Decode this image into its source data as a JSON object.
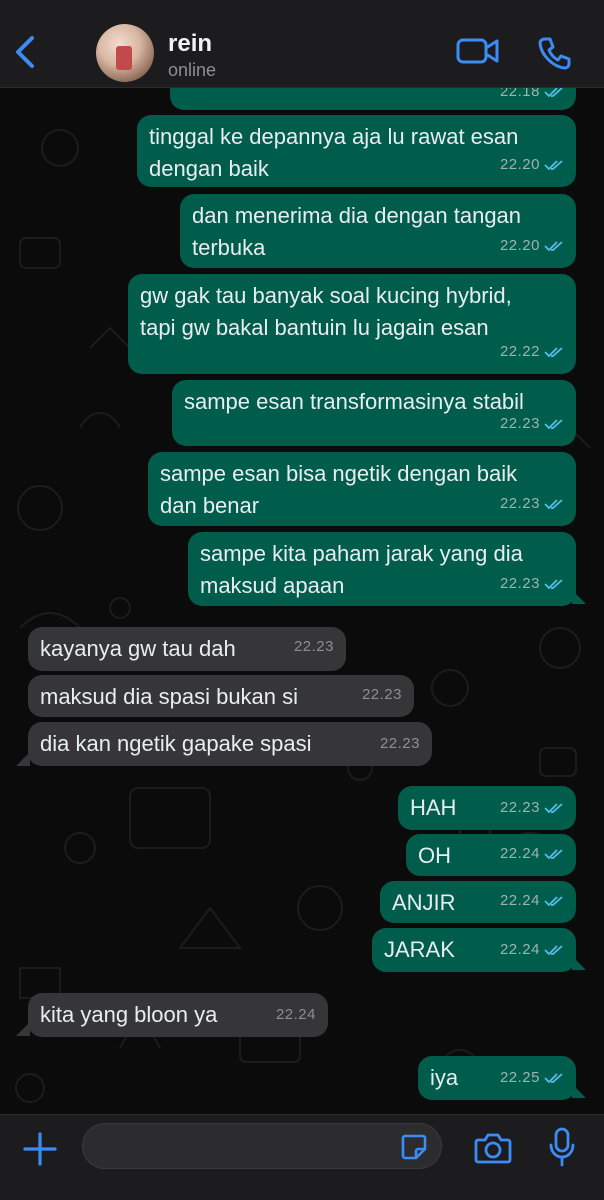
{
  "header": {
    "contact_name": "rein",
    "status": "online"
  },
  "messages": [
    {
      "dir": "out",
      "text": "",
      "time": "22.18",
      "read": true
    },
    {
      "dir": "out",
      "text": "tinggal ke depannya aja lu rawat esan\ndengan baik",
      "time": "22.20",
      "read": true
    },
    {
      "dir": "out",
      "text": "dan menerima dia dengan tangan\nterbuka",
      "time": "22.20",
      "read": true
    },
    {
      "dir": "out",
      "text": "gw gak tau banyak soal kucing hybrid,\ntapi gw bakal bantuin lu jagain esan",
      "time": "22.22",
      "read": true
    },
    {
      "dir": "out",
      "text": "sampe esan transformasinya stabil",
      "time": "22.23",
      "read": true
    },
    {
      "dir": "out",
      "text": "sampe esan bisa ngetik dengan baik\ndan benar",
      "time": "22.23",
      "read": true
    },
    {
      "dir": "out",
      "text": "sampe kita paham jarak yang dia\nmaksud apaan",
      "time": "22.23",
      "read": true
    },
    {
      "dir": "in",
      "text": "kayanya gw tau dah",
      "time": "22.23"
    },
    {
      "dir": "in",
      "text": "maksud dia spasi bukan si",
      "time": "22.23"
    },
    {
      "dir": "in",
      "text": "dia kan ngetik gapake spasi",
      "time": "22.23"
    },
    {
      "dir": "out",
      "text": "HAH",
      "time": "22.23",
      "read": true
    },
    {
      "dir": "out",
      "text": "OH",
      "time": "22.24",
      "read": true
    },
    {
      "dir": "out",
      "text": "ANJIR",
      "time": "22.24",
      "read": true
    },
    {
      "dir": "out",
      "text": "JARAK",
      "time": "22.24",
      "read": true
    },
    {
      "dir": "in",
      "text": "kita yang bloon ya",
      "time": "22.24"
    },
    {
      "dir": "out",
      "text": "iya",
      "time": "22.25",
      "read": true
    }
  ],
  "composer": {
    "placeholder": ""
  },
  "colors": {
    "accent": "#3b8cf5",
    "outgoing_bubble": "#005c4b",
    "incoming_bubble": "#363638",
    "read_ticks": "#53bdeb"
  },
  "icons": {
    "back": "chevron-left-icon",
    "video": "video-camera-icon",
    "call": "phone-icon",
    "add": "plus-icon",
    "sticker": "sticker-icon",
    "camera": "camera-icon",
    "mic": "microphone-icon"
  }
}
